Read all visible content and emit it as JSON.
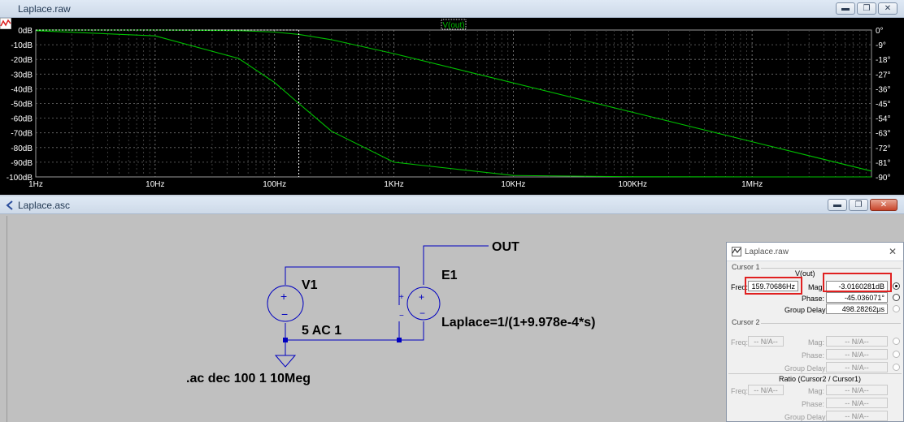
{
  "plot_window": {
    "title": "Laplace.raw",
    "trace_label": "V(out)",
    "mag_ticks": [
      "0dB",
      "-10dB",
      "-20dB",
      "-30dB",
      "-40dB",
      "-50dB",
      "-60dB",
      "-70dB",
      "-80dB",
      "-90dB",
      "-100dB"
    ],
    "phase_ticks": [
      "0°",
      "-9°",
      "-18°",
      "-27°",
      "-36°",
      "-45°",
      "-54°",
      "-63°",
      "-72°",
      "-81°",
      "-90°"
    ],
    "freq_ticks": [
      "1Hz",
      "10Hz",
      "100Hz",
      "1KHz",
      "10KHz",
      "100KHz",
      "1MHz"
    ],
    "trace_color": "#00c000",
    "background": "#000000"
  },
  "chart_data": {
    "type": "line",
    "title": "V(out)",
    "x_scale": "log",
    "xlim": [
      1,
      10000000
    ],
    "xlabel": "",
    "ylabel": "",
    "y_left": {
      "label": "",
      "ylim": [
        -100,
        0
      ],
      "unit": "dB"
    },
    "y_right": {
      "label": "",
      "ylim": [
        -90,
        0
      ],
      "unit": "°"
    },
    "cursor_x": 159.70686,
    "grid": true,
    "series": [
      {
        "name": "",
        "axis": "left",
        "unit": "dB",
        "x": [
          1,
          10,
          50,
          100,
          159.7,
          300,
          1000,
          10000,
          100000,
          1000000,
          10000000
        ],
        "values": [
          0,
          -0.02,
          -0.4,
          -1.4,
          -3.0,
          -6.6,
          -16.1,
          -36.0,
          -56.0,
          -76.0,
          -96.0
        ]
      },
      {
        "name": "",
        "axis": "right",
        "unit": "°",
        "x": [
          1,
          10,
          50,
          100,
          159.7,
          300,
          1000,
          10000,
          100000,
          1000000,
          10000000
        ],
        "values": [
          -0.4,
          -3.6,
          -17.4,
          -32.1,
          -45.0,
          -62.0,
          -81.0,
          -89.1,
          -89.9,
          -90.0,
          -90.0
        ]
      }
    ]
  },
  "schematic_window": {
    "title": "Laplace.asc",
    "v1_name": "V1",
    "v1_value": "5 AC 1",
    "e1_name": "E1",
    "e1_expr": "Laplace=1/(1+9.978e-4*s)",
    "net_out": "OUT",
    "directive": ".ac dec 100 1 10Meg",
    "wire_color": "#0000c0"
  },
  "cursor_dialog": {
    "title": "Laplace.raw",
    "close": "✕",
    "cursor1": {
      "group": "Cursor 1",
      "trace": "V(out)",
      "freq_label": "Freq:",
      "freq": "159.70686Hz",
      "mag_label": "Mag:",
      "mag": "-3.0160281dB",
      "phase_label": "Phase:",
      "phase": "-45.036071°",
      "gd_label": "Group Delay:",
      "gd": "498.28262µs"
    },
    "cursor2": {
      "group": "Cursor 2",
      "freq_label": "Freq:",
      "freq": "-- N/A--",
      "mag_label": "Mag:",
      "mag": "-- N/A--",
      "phase_label": "Phase:",
      "phase": "-- N/A--",
      "gd_label": "Group Delay:",
      "gd": "-- N/A--"
    },
    "ratio": {
      "group": "Ratio (Cursor2 / Cursor1)",
      "freq_label": "Freq:",
      "freq": "-- N/A--",
      "mag_label": "Mag:",
      "mag": "-- N/A--",
      "phase_label": "Phase:",
      "phase": "-- N/A--",
      "gd_label": "Group Delay:",
      "gd": "-- N/A--"
    }
  }
}
